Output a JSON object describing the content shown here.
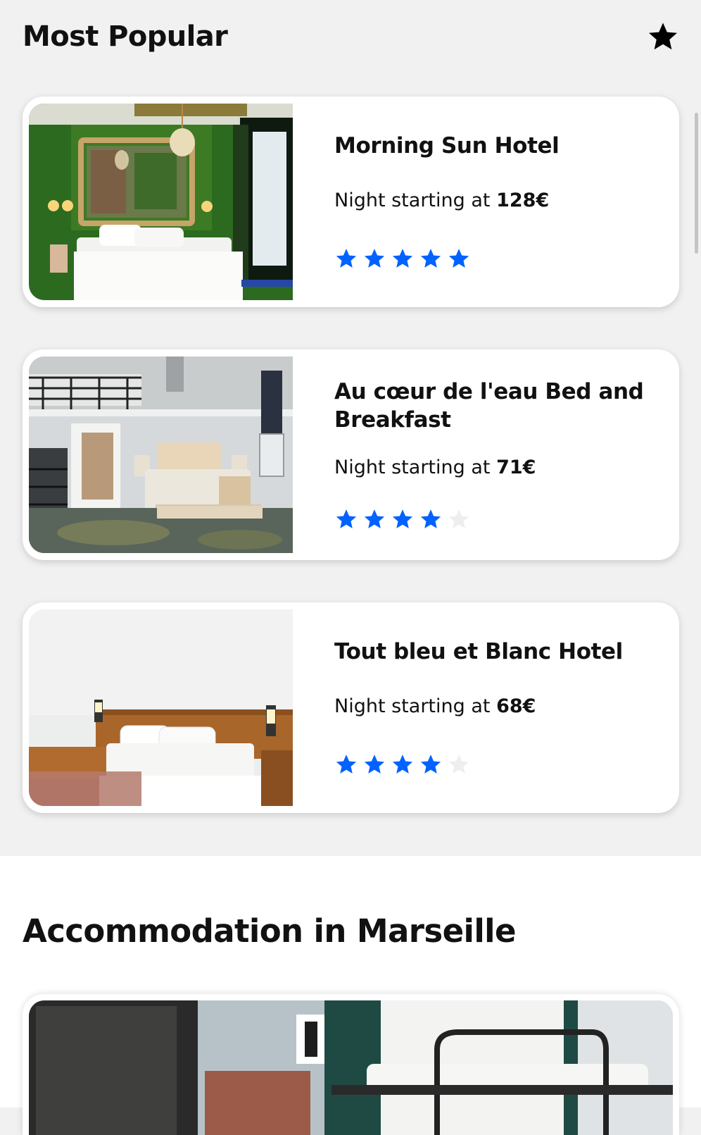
{
  "popular": {
    "title": "Most Popular",
    "favorite_icon": "star-icon"
  },
  "hotels": [
    {
      "name": "Morning Sun Hotel",
      "price_prefix": "Night starting at",
      "price": "128€",
      "rating": 5,
      "max_rating": 5
    },
    {
      "name": "Au cœur de l'eau Bed and Breakfast",
      "price_prefix": "Night starting at",
      "price": "71€",
      "rating": 4,
      "max_rating": 5
    },
    {
      "name": "Tout bleu et Blanc Hotel",
      "price_prefix": "Night starting at",
      "price": "68€",
      "rating": 4,
      "max_rating": 5
    }
  ],
  "accommodation": {
    "title": "Accommodation in Marseille"
  },
  "colors": {
    "star_active": "#0062ff",
    "star_inactive": "#eeeeee",
    "background": "#f1f1f2",
    "card": "#ffffff"
  }
}
